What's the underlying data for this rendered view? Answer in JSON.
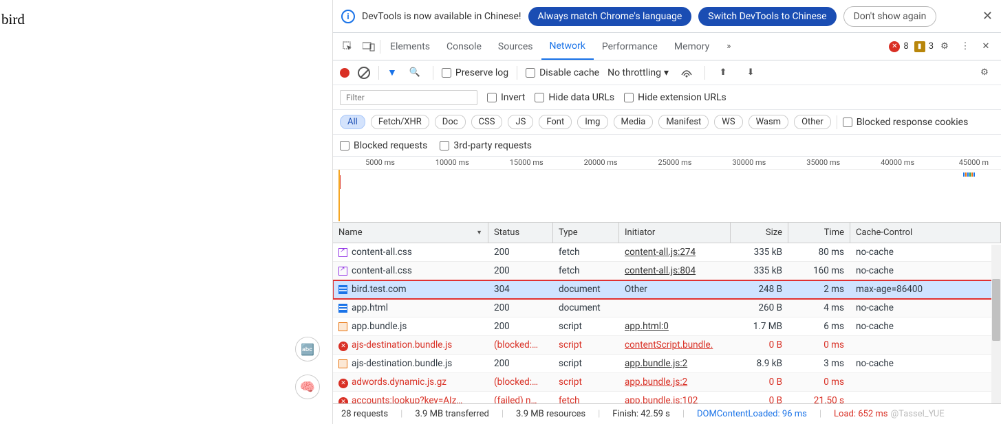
{
  "page": {
    "text": "bird"
  },
  "banner": {
    "message": "DevTools is now available in Chinese!",
    "btn1": "Always match Chrome's language",
    "btn2": "Switch DevTools to Chinese",
    "btn3": "Don't show again"
  },
  "tabs": {
    "items": [
      "Elements",
      "Console",
      "Sources",
      "Network",
      "Performance",
      "Memory"
    ],
    "active": 3,
    "errors": "8",
    "warnings": "3"
  },
  "toolbar": {
    "preserve": "Preserve log",
    "disable": "Disable cache",
    "throttling": "No throttling"
  },
  "filter": {
    "placeholder": "Filter",
    "invert": "Invert",
    "hide_data": "Hide data URLs",
    "hide_ext": "Hide extension URLs",
    "pills": [
      "All",
      "Fetch/XHR",
      "Doc",
      "CSS",
      "JS",
      "Font",
      "Img",
      "Media",
      "Manifest",
      "WS",
      "Wasm",
      "Other"
    ],
    "active_pill": 0,
    "blocked_cookies": "Blocked response cookies",
    "blocked_req": "Blocked requests",
    "third_party": "3rd-party requests"
  },
  "timeline": {
    "ticks": [
      "5000 ms",
      "10000 ms",
      "15000 ms",
      "20000 ms",
      "25000 ms",
      "30000 ms",
      "35000 ms",
      "40000 ms",
      "45000 m"
    ]
  },
  "columns": {
    "name": "Name",
    "status": "Status",
    "type": "Type",
    "initiator": "Initiator",
    "size": "Size",
    "time": "Time",
    "cache": "Cache-Control"
  },
  "rows": [
    {
      "icon": "css",
      "name": "content-all.css",
      "status": "200",
      "type": "fetch",
      "initiator": "content-all.js:274",
      "size": "335 kB",
      "time": "80 ms",
      "cache": "no-cache",
      "err": false
    },
    {
      "icon": "css",
      "name": "content-all.css",
      "status": "200",
      "type": "fetch",
      "initiator": "content-all.js:804",
      "size": "335 kB",
      "time": "160 ms",
      "cache": "no-cache",
      "err": false
    },
    {
      "icon": "doc",
      "name": "bird.test.com",
      "status": "304",
      "type": "document",
      "initiator": "Other",
      "size": "248 B",
      "time": "2 ms",
      "cache": "max-age=86400",
      "err": false,
      "selected": true,
      "highlight": true,
      "init_plain": true
    },
    {
      "icon": "doc",
      "name": "app.html",
      "status": "200",
      "type": "document",
      "initiator": "",
      "size": "260 B",
      "time": "4 ms",
      "cache": "no-cache",
      "err": false
    },
    {
      "icon": "js",
      "name": "app.bundle.js",
      "status": "200",
      "type": "script",
      "initiator": "app.html:0",
      "size": "1.7 MB",
      "time": "6 ms",
      "cache": "no-cache",
      "err": false
    },
    {
      "icon": "err",
      "name": "ajs-destination.bundle.js",
      "status": "(blocked:…",
      "type": "script",
      "initiator": "contentScript.bundle.",
      "size": "0 B",
      "time": "0 ms",
      "cache": "",
      "err": true
    },
    {
      "icon": "js",
      "name": "ajs-destination.bundle.js",
      "status": "200",
      "type": "script",
      "initiator": "app.bundle.js:2",
      "size": "8.9 kB",
      "time": "3 ms",
      "cache": "no-cache",
      "err": false
    },
    {
      "icon": "err",
      "name": "adwords.dynamic.js.gz",
      "status": "(blocked:…",
      "type": "script",
      "initiator": "app.bundle.js:2",
      "size": "0 B",
      "time": "0 ms",
      "cache": "",
      "err": true
    },
    {
      "icon": "err",
      "name": "accounts:lookup?key=AIz…",
      "status": "(failed) n…",
      "type": "fetch",
      "initiator": "app.bundle.js:102",
      "size": "0 B",
      "time": "21.50 s",
      "cache": "",
      "err": true
    }
  ],
  "status": {
    "requests": "28 requests",
    "transferred": "3.9 MB transferred",
    "resources": "3.9 MB resources",
    "finish": "Finish: 42.59 s",
    "dom": "DOMContentLoaded: 96 ms",
    "load": "Load: 652 ms",
    "watermark": "@Tassel_YUE"
  }
}
